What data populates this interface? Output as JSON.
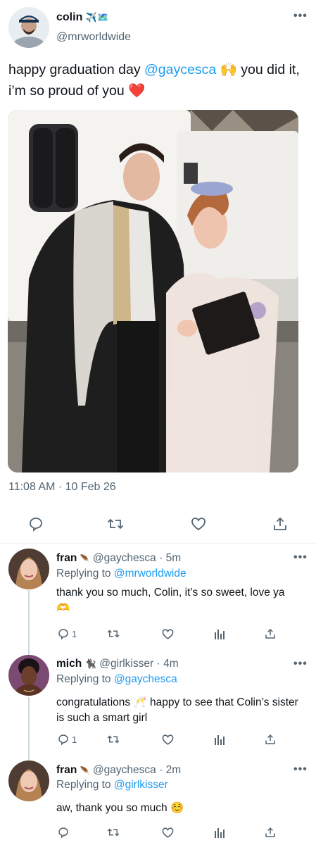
{
  "tweet": {
    "name": "colin",
    "name_emojis": "✈️🗺️",
    "handle": "@mrworldwide",
    "text_before": "happy graduation day ",
    "mention": "@gaycesca",
    "emoji_hands": "🙌",
    "text_after": " you did it, i’m so proud of you ",
    "emoji_heart": "❤️",
    "timestamp": "11:08 AM · 10 Feb 26"
  },
  "replies": [
    {
      "name": "fran",
      "badge": "🪶",
      "handle": "@gaychesca",
      "time": "· 5m",
      "replying_prefix": "Replying to ",
      "replying_to": "@mrworldwide",
      "text": "thank you so much, Colin, it’s so sweet, love ya 🫶",
      "reply_count": "1"
    },
    {
      "name": "mich",
      "badge": "🐈‍⬛",
      "handle": "@girlkisser",
      "time": "· 4m",
      "replying_prefix": "Replying to ",
      "replying_to": "@gaychesca",
      "text": "congratulations 🥂 happy to see that Colin’s sister is such a smart girl",
      "reply_count": "1"
    },
    {
      "name": "fran",
      "badge": "🪶",
      "handle": "@gaychesca",
      "time": "· 2m",
      "replying_prefix": "Replying to ",
      "replying_to": "@girlkisser",
      "text": "aw, thank you so much ☺️",
      "reply_count": ""
    }
  ],
  "icons": [
    "more-icon",
    "reply-icon",
    "retweet-icon",
    "like-icon",
    "share-icon",
    "analytics-icon"
  ],
  "colors": {
    "link": "#1d9bf0",
    "muted": "#536471",
    "text": "#0f1419",
    "heart": "#e0245e"
  }
}
